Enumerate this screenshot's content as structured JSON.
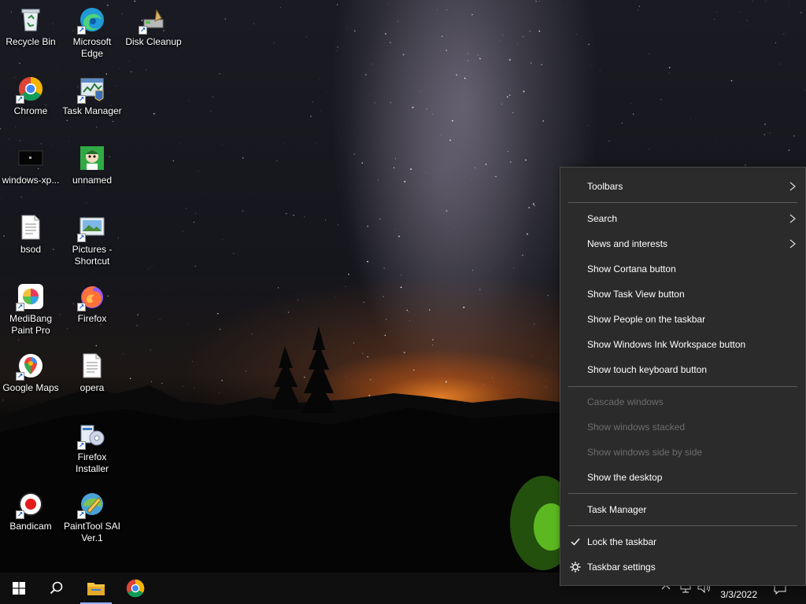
{
  "desktop": {
    "icons": [
      {
        "label": "Recycle Bin",
        "icon": "recycle-bin-icon"
      },
      {
        "label": "Microsoft\nEdge",
        "icon": "edge-icon"
      },
      {
        "label": "Disk Cleanup",
        "icon": "disk-cleanup-icon"
      },
      {
        "label": "Chrome",
        "icon": "chrome-icon"
      },
      {
        "label": "Task Manager",
        "icon": "task-manager-icon"
      },
      {
        "label": "windows-xp...",
        "icon": "video-thumbnail-icon"
      },
      {
        "label": "unnamed",
        "icon": "image-thumbnail-icon"
      },
      {
        "label": "bsod",
        "icon": "text-file-icon"
      },
      {
        "label": "Pictures -\nShortcut",
        "icon": "pictures-folder-icon"
      },
      {
        "label": "MediBang\nPaint Pro",
        "icon": "medibang-icon"
      },
      {
        "label": "Firefox",
        "icon": "firefox-icon"
      },
      {
        "label": "Google Maps",
        "icon": "google-maps-icon"
      },
      {
        "label": "opera",
        "icon": "text-file-icon"
      },
      {
        "label": "Firefox\nInstaller",
        "icon": "installer-icon"
      },
      {
        "label": "Bandicam",
        "icon": "bandicam-icon"
      },
      {
        "label": "PaintTool SAI\nVer.1",
        "icon": "painttool-sai-icon"
      }
    ]
  },
  "context_menu": {
    "toolbars": "Toolbars",
    "search": "Search",
    "news": "News and interests",
    "cortana": "Show Cortana button",
    "task_view": "Show Task View button",
    "people": "Show People on the taskbar",
    "ink": "Show Windows Ink Workspace button",
    "touch_keyboard": "Show touch keyboard button",
    "cascade": "Cascade windows",
    "stacked": "Show windows stacked",
    "side_by_side": "Show windows side by side",
    "show_desktop": "Show the desktop",
    "task_manager": "Task Manager",
    "lock": "Lock the taskbar",
    "settings": "Taskbar settings"
  },
  "taskbar": {
    "pinned": [
      "start-icon",
      "search-icon",
      "file-explorer-icon",
      "chrome-icon"
    ],
    "clock_date": "3/3/2022",
    "accent_color": "#8ab4f8"
  },
  "colors": {
    "menu_bg": "#2b2b2b",
    "menu_text": "#ffffff",
    "menu_disabled": "#6d6d6d",
    "taskbar_bg": "#0f0f10"
  }
}
